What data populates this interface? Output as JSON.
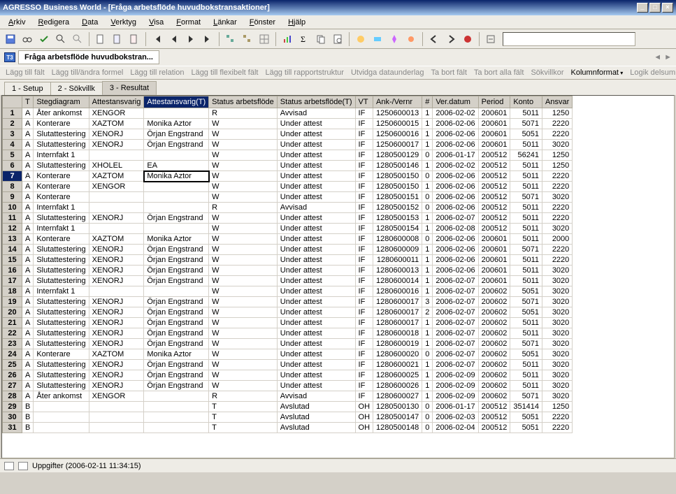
{
  "window": {
    "title": "AGRESSO Business World - [Fråga arbetsflöde huvudbokstransaktioner]"
  },
  "menu": [
    "Arkiv",
    "Redigera",
    "Data",
    "Verktyg",
    "Visa",
    "Format",
    "Länkar",
    "Fönster",
    "Hjälp"
  ],
  "breadcrumb": {
    "label": "Fråga arbetsflöde huvudbokstran..."
  },
  "linkbar": [
    "Lägg till fält",
    "Lägg till/ändra formel",
    "Lägg till relation",
    "Lägg till flexibelt fält",
    "Lägg till rapportstruktur",
    "Utvidga dataunderlag",
    "Ta bort fält",
    "Ta bort alla fält",
    "Sökvillkor",
    "Kolumnformat",
    "Logik delsumma"
  ],
  "linkbar_active_index": 9,
  "tabs": [
    "1 - Setup",
    "2 - Sökvillk",
    "3 - Resultat"
  ],
  "active_tab": 2,
  "columns": [
    "T",
    "Stegdiagram",
    "Attestansvarig",
    "Attestansvarig(T)",
    "Status arbetsflöde",
    "Status arbetsflöde(T)",
    "VT",
    "Ank-/Vernr",
    "#",
    "Ver.datum",
    "Period",
    "Konto",
    "Ansvar"
  ],
  "selected_col": 3,
  "selected_row": 7,
  "rows": [
    {
      "n": 1,
      "T": "A",
      "Stegdiagram": "Åter ankomst",
      "Attestansvarig": "XENGOR",
      "AttestT": "",
      "Status": "R",
      "StatusT": "Avvisad",
      "VT": "IF",
      "Ank": "1250600013",
      "Hash": "1",
      "Dat": "2006-02-02",
      "Per": "200601",
      "Konto": "5011",
      "Ansv": "1250"
    },
    {
      "n": 2,
      "T": "A",
      "Stegdiagram": "Konterare",
      "Attestansvarig": "XAZTOM",
      "AttestT": "Monika Aztor",
      "Status": "W",
      "StatusT": "Under attest",
      "VT": "IF",
      "Ank": "1250600015",
      "Hash": "1",
      "Dat": "2006-02-06",
      "Per": "200601",
      "Konto": "5071",
      "Ansv": "2220"
    },
    {
      "n": 3,
      "T": "A",
      "Stegdiagram": "Slutattestering",
      "Attestansvarig": "XENORJ",
      "AttestT": "Örjan Engstrand",
      "Status": "W",
      "StatusT": "Under attest",
      "VT": "IF",
      "Ank": "1250600016",
      "Hash": "1",
      "Dat": "2006-02-06",
      "Per": "200601",
      "Konto": "5051",
      "Ansv": "2220"
    },
    {
      "n": 4,
      "T": "A",
      "Stegdiagram": "Slutattestering",
      "Attestansvarig": "XENORJ",
      "AttestT": "Örjan Engstrand",
      "Status": "W",
      "StatusT": "Under attest",
      "VT": "IF",
      "Ank": "1250600017",
      "Hash": "1",
      "Dat": "2006-02-06",
      "Per": "200601",
      "Konto": "5011",
      "Ansv": "3020"
    },
    {
      "n": 5,
      "T": "A",
      "Stegdiagram": "Internfakt 1",
      "Attestansvarig": "",
      "AttestT": "",
      "Status": "W",
      "StatusT": "Under attest",
      "VT": "IF",
      "Ank": "1280500129",
      "Hash": "0",
      "Dat": "2006-01-17",
      "Per": "200512",
      "Konto": "56241",
      "Ansv": "1250"
    },
    {
      "n": 6,
      "T": "A",
      "Stegdiagram": "Slutattestering",
      "Attestansvarig": "XHOLEL",
      "AttestT": "EA",
      "Status": "W",
      "StatusT": "Under attest",
      "VT": "IF",
      "Ank": "1280500146",
      "Hash": "1",
      "Dat": "2006-02-02",
      "Per": "200512",
      "Konto": "5011",
      "Ansv": "1250"
    },
    {
      "n": 7,
      "T": "A",
      "Stegdiagram": "Konterare",
      "Attestansvarig": "XAZTOM",
      "AttestT": "Monika Aztor",
      "Status": "W",
      "StatusT": "Under attest",
      "VT": "IF",
      "Ank": "1280500150",
      "Hash": "0",
      "Dat": "2006-02-06",
      "Per": "200512",
      "Konto": "5011",
      "Ansv": "2220"
    },
    {
      "n": 8,
      "T": "A",
      "Stegdiagram": "Konterare",
      "Attestansvarig": "XENGOR",
      "AttestT": "",
      "Status": "W",
      "StatusT": "Under attest",
      "VT": "IF",
      "Ank": "1280500150",
      "Hash": "1",
      "Dat": "2006-02-06",
      "Per": "200512",
      "Konto": "5011",
      "Ansv": "2220"
    },
    {
      "n": 9,
      "T": "A",
      "Stegdiagram": "Konterare",
      "Attestansvarig": "",
      "AttestT": "",
      "Status": "W",
      "StatusT": "Under attest",
      "VT": "IF",
      "Ank": "1280500151",
      "Hash": "0",
      "Dat": "2006-02-06",
      "Per": "200512",
      "Konto": "5071",
      "Ansv": "3020"
    },
    {
      "n": 10,
      "T": "A",
      "Stegdiagram": "Internfakt 1",
      "Attestansvarig": "",
      "AttestT": "",
      "Status": "R",
      "StatusT": "Avvisad",
      "VT": "IF",
      "Ank": "1280500152",
      "Hash": "0",
      "Dat": "2006-02-06",
      "Per": "200512",
      "Konto": "5011",
      "Ansv": "2220"
    },
    {
      "n": 11,
      "T": "A",
      "Stegdiagram": "Slutattestering",
      "Attestansvarig": "XENORJ",
      "AttestT": "Örjan Engstrand",
      "Status": "W",
      "StatusT": "Under attest",
      "VT": "IF",
      "Ank": "1280500153",
      "Hash": "1",
      "Dat": "2006-02-07",
      "Per": "200512",
      "Konto": "5011",
      "Ansv": "2220"
    },
    {
      "n": 12,
      "T": "A",
      "Stegdiagram": "Internfakt 1",
      "Attestansvarig": "",
      "AttestT": "",
      "Status": "W",
      "StatusT": "Under attest",
      "VT": "IF",
      "Ank": "1280500154",
      "Hash": "1",
      "Dat": "2006-02-08",
      "Per": "200512",
      "Konto": "5011",
      "Ansv": "3020"
    },
    {
      "n": 13,
      "T": "A",
      "Stegdiagram": "Konterare",
      "Attestansvarig": "XAZTOM",
      "AttestT": "Monika Aztor",
      "Status": "W",
      "StatusT": "Under attest",
      "VT": "IF",
      "Ank": "1280600008",
      "Hash": "0",
      "Dat": "2006-02-06",
      "Per": "200601",
      "Konto": "5011",
      "Ansv": "2000"
    },
    {
      "n": 14,
      "T": "A",
      "Stegdiagram": "Slutattestering",
      "Attestansvarig": "XENORJ",
      "AttestT": "Örjan Engstrand",
      "Status": "W",
      "StatusT": "Under attest",
      "VT": "IF",
      "Ank": "1280600009",
      "Hash": "1",
      "Dat": "2006-02-06",
      "Per": "200601",
      "Konto": "5071",
      "Ansv": "2220"
    },
    {
      "n": 15,
      "T": "A",
      "Stegdiagram": "Slutattestering",
      "Attestansvarig": "XENORJ",
      "AttestT": "Örjan Engstrand",
      "Status": "W",
      "StatusT": "Under attest",
      "VT": "IF",
      "Ank": "1280600011",
      "Hash": "1",
      "Dat": "2006-02-06",
      "Per": "200601",
      "Konto": "5011",
      "Ansv": "2220"
    },
    {
      "n": 16,
      "T": "A",
      "Stegdiagram": "Slutattestering",
      "Attestansvarig": "XENORJ",
      "AttestT": "Örjan Engstrand",
      "Status": "W",
      "StatusT": "Under attest",
      "VT": "IF",
      "Ank": "1280600013",
      "Hash": "1",
      "Dat": "2006-02-06",
      "Per": "200601",
      "Konto": "5011",
      "Ansv": "3020"
    },
    {
      "n": 17,
      "T": "A",
      "Stegdiagram": "Slutattestering",
      "Attestansvarig": "XENORJ",
      "AttestT": "Örjan Engstrand",
      "Status": "W",
      "StatusT": "Under attest",
      "VT": "IF",
      "Ank": "1280600014",
      "Hash": "1",
      "Dat": "2006-02-07",
      "Per": "200601",
      "Konto": "5011",
      "Ansv": "3020"
    },
    {
      "n": 18,
      "T": "A",
      "Stegdiagram": "Internfakt 1",
      "Attestansvarig": "",
      "AttestT": "",
      "Status": "W",
      "StatusT": "Under attest",
      "VT": "IF",
      "Ank": "1280600016",
      "Hash": "1",
      "Dat": "2006-02-07",
      "Per": "200602",
      "Konto": "5051",
      "Ansv": "3020"
    },
    {
      "n": 19,
      "T": "A",
      "Stegdiagram": "Slutattestering",
      "Attestansvarig": "XENORJ",
      "AttestT": "Örjan Engstrand",
      "Status": "W",
      "StatusT": "Under attest",
      "VT": "IF",
      "Ank": "1280600017",
      "Hash": "3",
      "Dat": "2006-02-07",
      "Per": "200602",
      "Konto": "5071",
      "Ansv": "3020"
    },
    {
      "n": 20,
      "T": "A",
      "Stegdiagram": "Slutattestering",
      "Attestansvarig": "XENORJ",
      "AttestT": "Örjan Engstrand",
      "Status": "W",
      "StatusT": "Under attest",
      "VT": "IF",
      "Ank": "1280600017",
      "Hash": "2",
      "Dat": "2006-02-07",
      "Per": "200602",
      "Konto": "5051",
      "Ansv": "3020"
    },
    {
      "n": 21,
      "T": "A",
      "Stegdiagram": "Slutattestering",
      "Attestansvarig": "XENORJ",
      "AttestT": "Örjan Engstrand",
      "Status": "W",
      "StatusT": "Under attest",
      "VT": "IF",
      "Ank": "1280600017",
      "Hash": "1",
      "Dat": "2006-02-07",
      "Per": "200602",
      "Konto": "5011",
      "Ansv": "3020"
    },
    {
      "n": 22,
      "T": "A",
      "Stegdiagram": "Slutattestering",
      "Attestansvarig": "XENORJ",
      "AttestT": "Örjan Engstrand",
      "Status": "W",
      "StatusT": "Under attest",
      "VT": "IF",
      "Ank": "1280600018",
      "Hash": "1",
      "Dat": "2006-02-07",
      "Per": "200602",
      "Konto": "5011",
      "Ansv": "3020"
    },
    {
      "n": 23,
      "T": "A",
      "Stegdiagram": "Slutattestering",
      "Attestansvarig": "XENORJ",
      "AttestT": "Örjan Engstrand",
      "Status": "W",
      "StatusT": "Under attest",
      "VT": "IF",
      "Ank": "1280600019",
      "Hash": "1",
      "Dat": "2006-02-07",
      "Per": "200602",
      "Konto": "5071",
      "Ansv": "3020"
    },
    {
      "n": 24,
      "T": "A",
      "Stegdiagram": "Konterare",
      "Attestansvarig": "XAZTOM",
      "AttestT": "Monika Aztor",
      "Status": "W",
      "StatusT": "Under attest",
      "VT": "IF",
      "Ank": "1280600020",
      "Hash": "0",
      "Dat": "2006-02-07",
      "Per": "200602",
      "Konto": "5051",
      "Ansv": "3020"
    },
    {
      "n": 25,
      "T": "A",
      "Stegdiagram": "Slutattestering",
      "Attestansvarig": "XENORJ",
      "AttestT": "Örjan Engstrand",
      "Status": "W",
      "StatusT": "Under attest",
      "VT": "IF",
      "Ank": "1280600021",
      "Hash": "1",
      "Dat": "2006-02-07",
      "Per": "200602",
      "Konto": "5011",
      "Ansv": "3020"
    },
    {
      "n": 26,
      "T": "A",
      "Stegdiagram": "Slutattestering",
      "Attestansvarig": "XENORJ",
      "AttestT": "Örjan Engstrand",
      "Status": "W",
      "StatusT": "Under attest",
      "VT": "IF",
      "Ank": "1280600025",
      "Hash": "1",
      "Dat": "2006-02-09",
      "Per": "200602",
      "Konto": "5011",
      "Ansv": "3020"
    },
    {
      "n": 27,
      "T": "A",
      "Stegdiagram": "Slutattestering",
      "Attestansvarig": "XENORJ",
      "AttestT": "Örjan Engstrand",
      "Status": "W",
      "StatusT": "Under attest",
      "VT": "IF",
      "Ank": "1280600026",
      "Hash": "1",
      "Dat": "2006-02-09",
      "Per": "200602",
      "Konto": "5011",
      "Ansv": "3020"
    },
    {
      "n": 28,
      "T": "A",
      "Stegdiagram": "Åter ankomst",
      "Attestansvarig": "XENGOR",
      "AttestT": "",
      "Status": "R",
      "StatusT": "Avvisad",
      "VT": "IF",
      "Ank": "1280600027",
      "Hash": "1",
      "Dat": "2006-02-09",
      "Per": "200602",
      "Konto": "5071",
      "Ansv": "3020"
    },
    {
      "n": 29,
      "T": "B",
      "Stegdiagram": "",
      "Attestansvarig": "",
      "AttestT": "",
      "Status": "T",
      "StatusT": "Avslutad",
      "VT": "OH",
      "Ank": "1280500130",
      "Hash": "0",
      "Dat": "2006-01-17",
      "Per": "200512",
      "Konto": "351414",
      "Ansv": "1250"
    },
    {
      "n": 30,
      "T": "B",
      "Stegdiagram": "",
      "Attestansvarig": "",
      "AttestT": "",
      "Status": "T",
      "StatusT": "Avslutad",
      "VT": "OH",
      "Ank": "1280500147",
      "Hash": "0",
      "Dat": "2006-02-03",
      "Per": "200512",
      "Konto": "5051",
      "Ansv": "2220"
    },
    {
      "n": 31,
      "T": "B",
      "Stegdiagram": "",
      "Attestansvarig": "",
      "AttestT": "",
      "Status": "T",
      "StatusT": "Avslutad",
      "VT": "OH",
      "Ank": "1280500148",
      "Hash": "0",
      "Dat": "2006-02-04",
      "Per": "200512",
      "Konto": "5051",
      "Ansv": "2220"
    }
  ],
  "status": {
    "text": "Uppgifter (2006-02-11 11:34:15)"
  }
}
